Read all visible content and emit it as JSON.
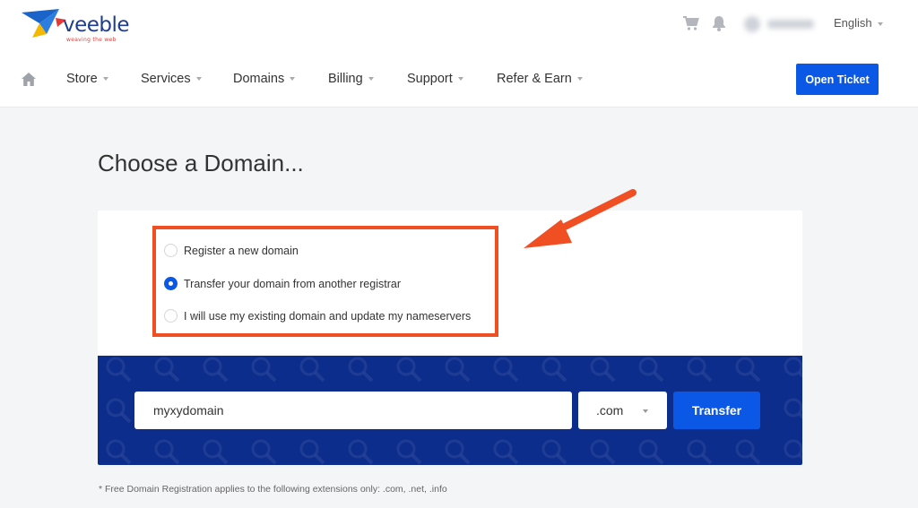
{
  "brand": {
    "name": "veeble",
    "tagline": "weaving the web"
  },
  "header": {
    "icons": [
      "cart-icon",
      "bell-icon"
    ],
    "language": "English"
  },
  "nav": {
    "home_icon": "home-icon",
    "items": [
      {
        "label": "Store"
      },
      {
        "label": "Services"
      },
      {
        "label": "Domains"
      },
      {
        "label": "Billing"
      },
      {
        "label": "Support"
      },
      {
        "label": "Refer & Earn"
      }
    ],
    "open_ticket": "Open Ticket"
  },
  "page": {
    "title": "Choose a Domain..."
  },
  "options": [
    {
      "label": "Register a new domain",
      "selected": false
    },
    {
      "label": "Transfer your domain from another registrar",
      "selected": true
    },
    {
      "label": "I will use my existing domain and update my nameservers",
      "selected": false
    }
  ],
  "search": {
    "value": "myxydomain",
    "tld": ".com",
    "button": "Transfer"
  },
  "footnote": "* Free Domain Registration applies to the following extensions only: .com, .net, .info",
  "colors": {
    "accent": "#0c58e6",
    "band": "#0d2d8c",
    "annotation": "#f04e23"
  }
}
